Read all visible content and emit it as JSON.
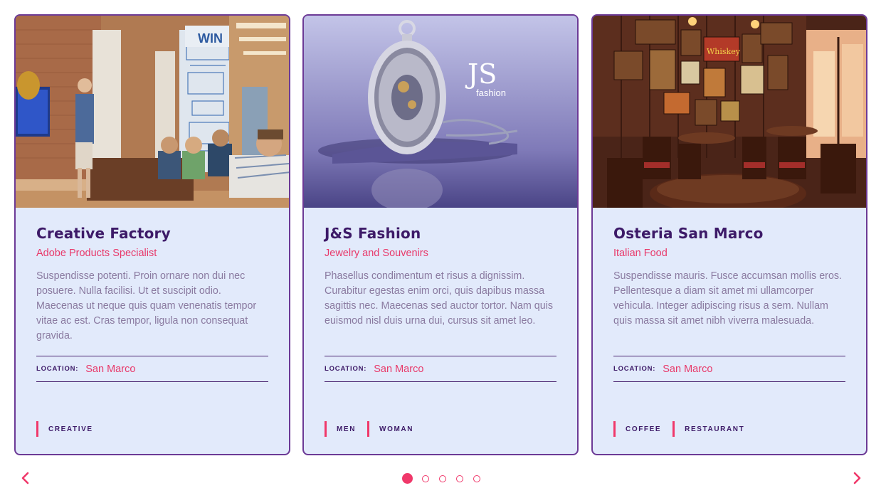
{
  "cards": [
    {
      "title": "Creative Factory",
      "subtitle": "Adobe Products Specialist",
      "description": "Suspendisse potenti. Proin ornare non dui nec posuere. Nulla facilisi. Ut et suscipit odio. Maecenas ut neque quis quam venenatis tempor vitae ac est. Cras tempor, ligula non consequat gravida.",
      "location_label": "LOCATION:",
      "location": "San Marco",
      "tags": [
        "CREATIVE"
      ],
      "image_logo": "WIN"
    },
    {
      "title": "J&S Fashion",
      "subtitle": "Jewelry and Souvenirs",
      "description": "Phasellus condimentum et risus a dignissim. Curabitur egestas enim orci, quis dapibus massa sagittis nec. Maecenas sed auctor tortor. Nam quis euismod nisl duis urna dui, cursus sit amet leo.",
      "location_label": "LOCATION:",
      "location": "San Marco",
      "tags": [
        "MEN",
        "WOMAN"
      ],
      "image_logo": "JS",
      "image_logo_sub": "fashion"
    },
    {
      "title": "Osteria San Marco",
      "subtitle": "Italian Food",
      "description": "Suspendisse mauris. Fusce accumsan mollis eros. Pellentesque a diam sit amet mi ullamcorper vehicula. Integer adipiscing risus a sem. Nullam quis massa sit amet nibh viverra malesuada.",
      "location_label": "LOCATION:",
      "location": "San Marco",
      "tags": [
        "COFFEE",
        "RESTAURANT"
      ],
      "image_sign": "Whiskey"
    }
  ],
  "carousel": {
    "page_count": 5,
    "active_page": 1,
    "prev_icon": "chevron-left-icon",
    "next_icon": "chevron-right-icon"
  },
  "colors": {
    "accent": "#f0386a",
    "title": "#3d1a68",
    "card_bg": "#e2eafb",
    "card_border": "#6c3a96"
  }
}
